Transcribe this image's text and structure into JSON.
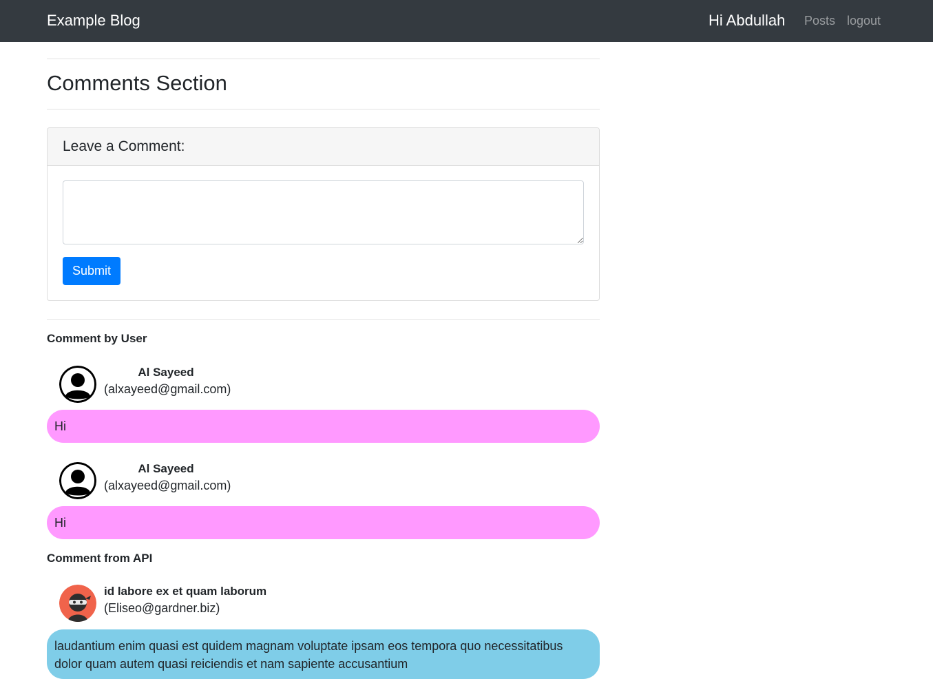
{
  "navbar": {
    "brand": "Example Blog",
    "greeting": "Hi Abdullah",
    "links": [
      "Posts",
      "logout"
    ]
  },
  "main": {
    "section_title": "Comments Section",
    "comment_form": {
      "header": "Leave a Comment:",
      "textarea_value": "",
      "submit_label": "Submit"
    },
    "user_comments_heading": "Comment by User",
    "user_comments": [
      {
        "name": "Al Sayeed",
        "email": "(alxayeed@gmail.com)",
        "text": "Hi"
      },
      {
        "name": "Al Sayeed",
        "email": "(alxayeed@gmail.com)",
        "text": "Hi"
      }
    ],
    "api_comments_heading": "Comment from API",
    "api_comments": [
      {
        "name": "id labore ex et quam laborum",
        "email": "(Eliseo@gardner.biz)",
        "text": "laudantium enim quasi est quidem magnam voluptate ipsam eos tempora quo necessitatibus dolor quam autem quasi reiciendis et nam sapiente accusantium"
      }
    ]
  },
  "colors": {
    "navbar_bg": "#343a40",
    "user_bubble": "#ff99ff",
    "api_bubble": "#7fcde8",
    "primary": "#007bff",
    "ninja_avatar_bg": "#f0634b"
  },
  "icons": {
    "user_avatar": "user-silhouette-icon",
    "api_avatar": "ninja-avatar-icon"
  }
}
